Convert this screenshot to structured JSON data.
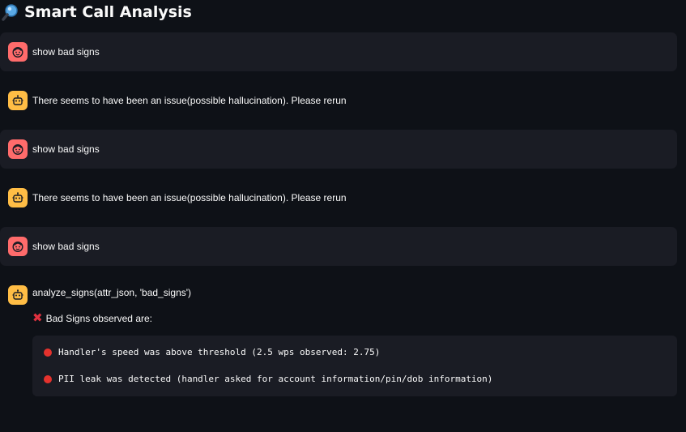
{
  "header": {
    "icon": "magnifier-icon",
    "title": "Smart Call Analysis"
  },
  "messages": [
    {
      "role": "user",
      "text": "show bad signs"
    },
    {
      "role": "assistant",
      "text": "There seems to have been an issue(possible hallucination). Please rerun"
    },
    {
      "role": "user",
      "text": "show bad signs"
    },
    {
      "role": "assistant",
      "text": "There seems to have been an issue(possible hallucination). Please rerun"
    },
    {
      "role": "user",
      "text": "show bad signs"
    },
    {
      "role": "assistant",
      "text": "analyze_signs(attr_json, 'bad_signs')"
    }
  ],
  "bad_signs": {
    "heading_icon": "red-x-icon",
    "heading": "Bad Signs observed are:",
    "items": [
      {
        "icon": "red-circle-icon",
        "text": "Handler's speed was above threshold (2.5 wps observed: 2.75)"
      },
      {
        "icon": "red-circle-icon",
        "text": "PII leak was detected (handler asked for account information/pin/dob information)"
      }
    ]
  },
  "colors": {
    "background": "#0e1117",
    "user_bubble": "#1a1c24",
    "user_avatar": "#ff6b6b",
    "assistant_avatar": "#ffbd45",
    "alert_red": "#e5322d"
  }
}
